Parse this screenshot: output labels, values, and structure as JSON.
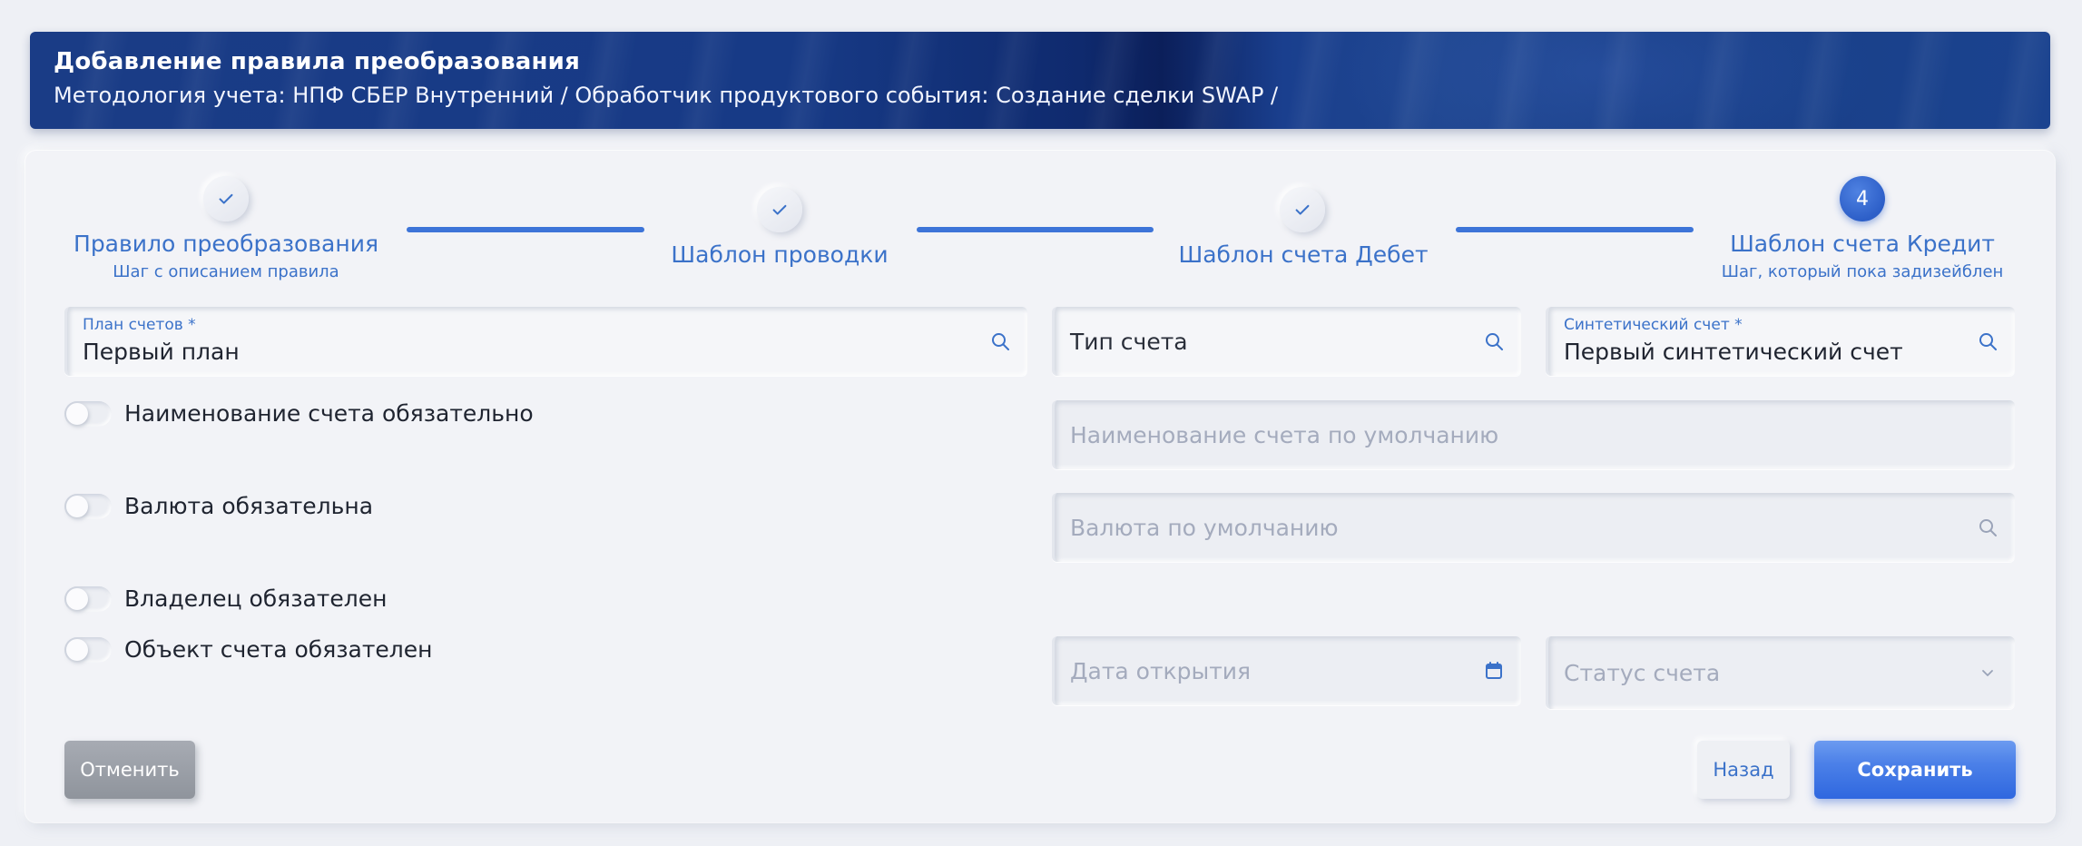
{
  "header": {
    "title": "Добавление правила преобразования",
    "breadcrumb": "Методология учета: НПФ СБЕР Внутренний / Обработчик продуктового события: Создание сделки SWAP /"
  },
  "stepper": {
    "steps": [
      {
        "number": "1",
        "title": "Правило преобразования",
        "subtitle": "Шаг с описанием правила",
        "status": "done"
      },
      {
        "number": "2",
        "title": "Шаблон проводки",
        "subtitle": "",
        "status": "done"
      },
      {
        "number": "3",
        "title": "Шаблон счета Дебет",
        "subtitle": "",
        "status": "done"
      },
      {
        "number": "4",
        "title": "Шаблон счета Кредит",
        "subtitle": "Шаг, который пока задизейблен",
        "status": "active"
      }
    ]
  },
  "form": {
    "chart_of_accounts": {
      "label": "План счетов *",
      "value": "Первый план",
      "icon": "search-icon"
    },
    "account_type": {
      "placeholder": "Тип счета",
      "icon": "search-icon"
    },
    "synthetic_account": {
      "label": "Синтетический счет *",
      "value": "Первый синтетический счет",
      "icon": "search-icon"
    },
    "default_account_name": {
      "placeholder": "Наименование счета по умолчанию"
    },
    "default_currency": {
      "placeholder": "Валюта по умолчанию",
      "icon": "search-icon"
    },
    "opening_date": {
      "placeholder": "Дата открытия",
      "icon": "calendar-icon"
    },
    "account_status": {
      "placeholder": "Статус счета",
      "icon": "chevron-down-icon"
    },
    "toggles": {
      "name_required": {
        "label": "Наименование счета обязательно",
        "on": false
      },
      "currency_required": {
        "label": "Валюта обязательна",
        "on": false
      },
      "owner_required": {
        "label": "Владелец обязателен",
        "on": false
      },
      "object_required": {
        "label": "Объект счета обязателен",
        "on": false
      }
    }
  },
  "actions": {
    "cancel": "Отменить",
    "back": "Назад",
    "save": "Сохранить"
  },
  "colors": {
    "accent": "#3b72c9",
    "header": "#1a3c86",
    "save": "#2f67df"
  }
}
